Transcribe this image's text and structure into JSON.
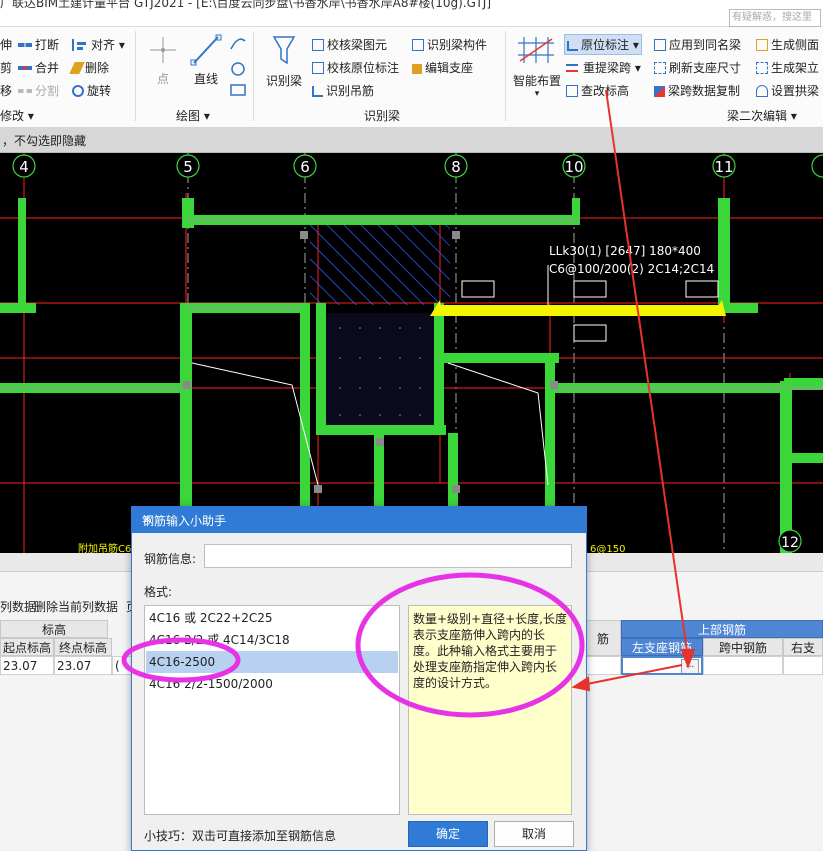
{
  "app": {
    "title": "广联达BIM土建计量平台 GTJ2021 - [E:\\百度云同步盘\\书香水岸\\书香水岸A8#楼(10g).GTJ]",
    "search_placeholder": "有疑解惑，搜这里"
  },
  "ribbon": {
    "left_group": {
      "items": [
        "伸",
        "打断",
        "对齐",
        "剪",
        "合并",
        "删除",
        "移",
        "分割",
        "旋转"
      ],
      "group_label": "修改"
    },
    "draw_group": {
      "point_label": "点",
      "line_label": "直线",
      "group_label": "绘图"
    },
    "identify_group": {
      "identify_beam": "识别梁",
      "check_element": "校核梁图元",
      "check_origin": "校核原位标注",
      "identify_hanger": "识别吊筋",
      "identify_component": "识别梁构件",
      "edit_support": "编辑支座",
      "group_label": "识别梁"
    },
    "secondary_group": {
      "smart_layout": "智能布置",
      "origin_mark": "原位标注",
      "lift_span": "重提梁跨",
      "check_elev": "查改标高",
      "apply_same": "应用到同名梁",
      "refresh_support": "刷新支座尺寸",
      "span_copy": "梁跨数据复制",
      "gen_side": "生成侧面",
      "gen_frame": "生成架立",
      "set_arch": "设置拱梁",
      "group_label": "梁二次编辑"
    }
  },
  "infobar": {
    "text": "，不勾选即隐藏"
  },
  "canvas": {
    "axis_labels": [
      "4",
      "5",
      "6",
      "8",
      "10",
      "11",
      "12"
    ],
    "beam_annotation_line1": "LLk30(1) [2647] 180*400",
    "beam_annotation_line2": "C6@100/200(2) 2C14;2C14",
    "bottom_text_left": "附加吊筋C6@1",
    "bottom_text_right": "6@150"
  },
  "bottom": {
    "toolbar": [
      "列数据",
      "删除当前列数据",
      "页"
    ],
    "headers": {
      "elev": "标高",
      "start_elev": "起点标高",
      "end_elev": "终点标高",
      "rebar": "筋",
      "top_rebar": "上部钢筋",
      "left_support": "左支座钢筋",
      "mid_span": "跨中钢筋",
      "right_support": "右支"
    },
    "row": {
      "start": "23.07",
      "end": "23.07",
      "misc": "(",
      "ellipsis": "..."
    }
  },
  "dialog": {
    "title": "钢筋输入小助手",
    "close": "×",
    "info_label": "钢筋信息:",
    "info_value": "",
    "format_label": "格式:",
    "formats": [
      "4C16 或 2C22+2C25",
      "4C16 2/2 或 4C14/3C18",
      "4C16-2500",
      "4C16 2/2-1500/2000"
    ],
    "selected_index": 2,
    "description": "数量+级别+直径+长度,长度表示支座筋伸入跨内的长度。此种输入格式主要用于处理支座筋指定伸入跨内长度的设计方式。",
    "tip": "小技巧：双击可直接添加至钢筋信息",
    "ok": "确定",
    "cancel": "取消"
  },
  "colors": {
    "accent": "#2f7bd6",
    "beam_green": "#3ad63a",
    "highlight_yellow": "#f4f400",
    "annotation_magenta": "#e633e6",
    "arrow_red": "#e8322e",
    "desc_bg": "#ffffcc"
  }
}
